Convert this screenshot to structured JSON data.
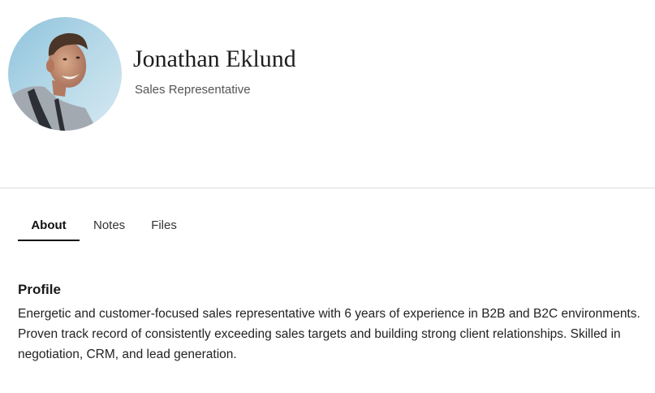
{
  "profile_header": {
    "name": "Jonathan Eklund",
    "role": "Sales Representative",
    "avatar_icon": "person-photo-avatar"
  },
  "tabs": [
    {
      "label": "About",
      "active": true
    },
    {
      "label": "Notes",
      "active": false
    },
    {
      "label": "Files",
      "active": false
    }
  ],
  "about": {
    "section_title": "Profile",
    "description": "Energetic and customer-focused sales representative with 6 years of experience in B2B and B2C environments. Proven track record of consistently exceeding sales targets and building strong client relationships. Skilled in negotiation, CRM, and lead generation."
  },
  "colors": {
    "active_tab_underline": "#111111",
    "divider": "#dedede",
    "secondary_text": "#555555"
  }
}
